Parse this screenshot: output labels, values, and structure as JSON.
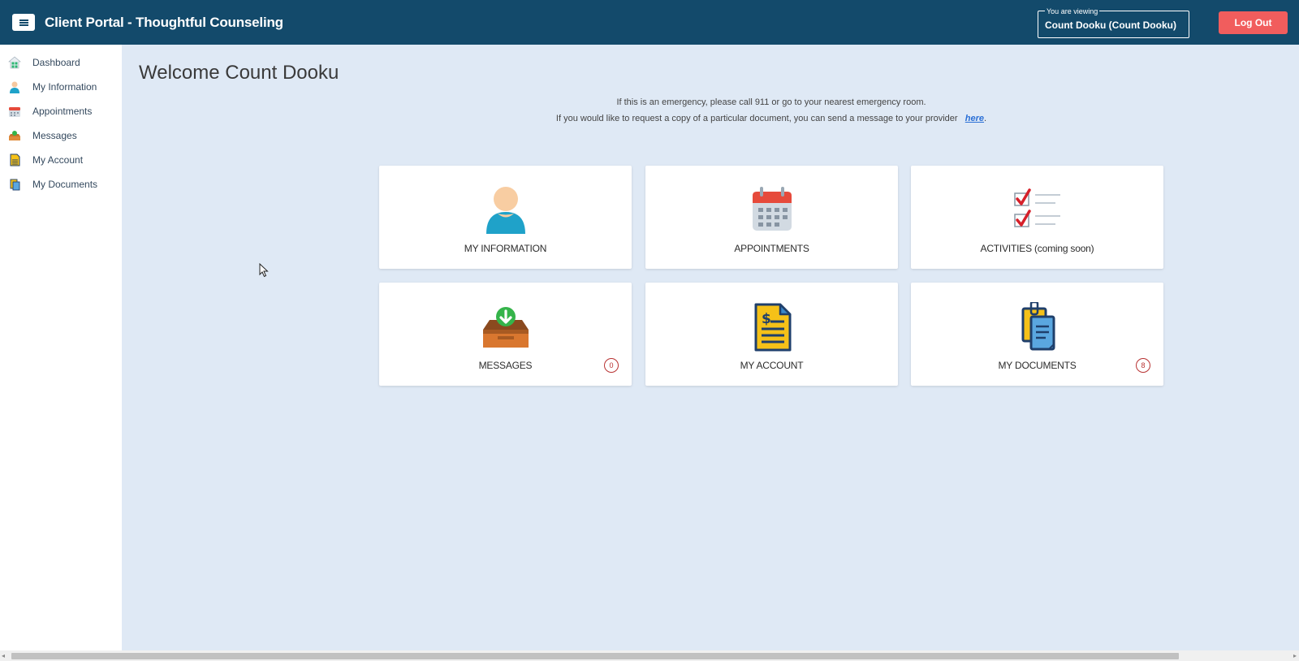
{
  "header": {
    "menu_icon": "hamburger-icon",
    "title": "Client Portal - Thoughtful Counseling",
    "viewing_legend": "You are viewing",
    "viewing_value": "Count Dooku (Count Dooku)",
    "logout_label": "Log Out",
    "colors": {
      "bar": "#134a6b",
      "logout": "#f15d5d"
    }
  },
  "sidebar": {
    "items": [
      {
        "label": "Dashboard",
        "icon": "dashboard-icon"
      },
      {
        "label": "My Information",
        "icon": "person-icon"
      },
      {
        "label": "Appointments",
        "icon": "calendar-icon"
      },
      {
        "label": "Messages",
        "icon": "inbox-icon"
      },
      {
        "label": "My Account",
        "icon": "invoice-icon"
      },
      {
        "label": "My Documents",
        "icon": "documents-icon"
      }
    ]
  },
  "main": {
    "welcome": "Welcome Count Dooku",
    "notice_emergency": "If this is an emergency, please call 911 or go to your nearest emergency room.",
    "notice_document": "If you would like to request a copy of a particular document, you can send a message to your provider",
    "notice_link": "here",
    "notice_end": ".",
    "cards": [
      {
        "label": "MY INFORMATION",
        "icon": "person-icon"
      },
      {
        "label": "APPOINTMENTS",
        "icon": "calendar-icon"
      },
      {
        "label": "ACTIVITIES (coming soon)",
        "icon": "checklist-icon"
      },
      {
        "label": "MESSAGES",
        "icon": "inbox-icon",
        "badge": "0"
      },
      {
        "label": "MY ACCOUNT",
        "icon": "invoice-icon"
      },
      {
        "label": "MY DOCUMENTS",
        "icon": "documents-icon",
        "badge": "8"
      }
    ]
  },
  "colors": {
    "page_bg": "#dfe9f5",
    "badge": "#b83232",
    "link": "#2a6fd6"
  }
}
